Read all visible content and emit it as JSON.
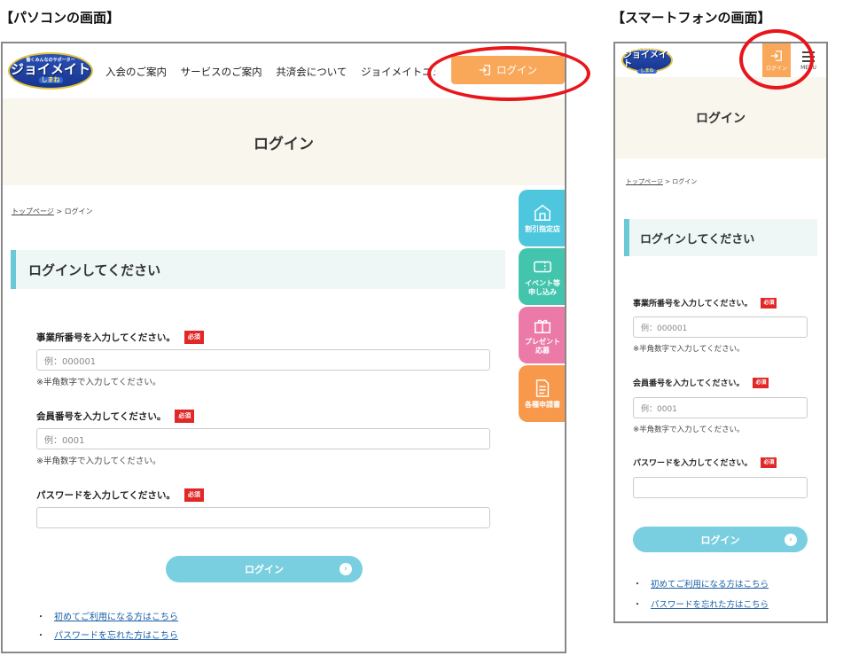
{
  "captions": {
    "pc": "【パソコンの画面】",
    "sp": "【スマートフォンの画面】"
  },
  "logo": {
    "tagline": "働くみんなのサポーター",
    "main": "ジョイメイト",
    "sub": "しまね"
  },
  "nav": [
    "入会のご案内",
    "サービスのご案内",
    "共済会について",
    "ジョイメイトニュース"
  ],
  "login_button": "ログイン",
  "menu_label": "MENU",
  "page_title": "ログイン",
  "breadcrumb": {
    "home": "トップページ",
    "separator": ">",
    "current": "ログイン"
  },
  "section_title": "ログインしてください",
  "side_tabs": [
    "割引指定店",
    "イベント等\n申し込み",
    "プレゼント\n応募",
    "各種申請書"
  ],
  "form": {
    "office_label": "事業所番号を入力してください。",
    "office_placeholder": "例：000001",
    "office_note": "※半角数字で入力してください。",
    "member_label": "会員番号を入力してください。",
    "member_placeholder": "例：0001",
    "member_note": "※半角数字で入力してください。",
    "password_label": "パスワードを入力してください。",
    "required": "必須",
    "submit": "ログイン",
    "submit_arrow": "›"
  },
  "links": {
    "bullet": "・",
    "first_time": "初めてご利用になる方はこちら",
    "forgot": "パスワードを忘れた方はこちら"
  },
  "colors": {
    "accent_orange": "#f9a85a",
    "button_blue": "#79cfe0",
    "required_red": "#e12727",
    "highlight_red": "#e8151b",
    "hero_bg": "#f8f6ed"
  }
}
